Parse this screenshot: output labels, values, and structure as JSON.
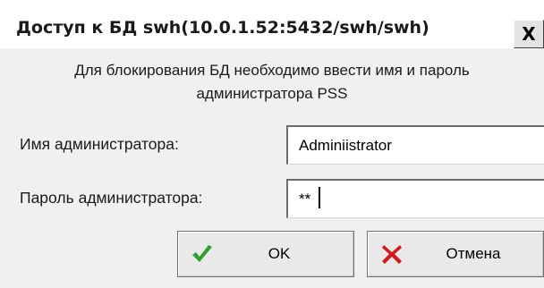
{
  "window": {
    "title": "Доступ к БД swh(10.0.1.52:5432/swh/swh)",
    "close_label": "X"
  },
  "message": {
    "line1": "Для блокирования БД необходимо ввести имя и пароль",
    "line2": "администратора PSS"
  },
  "form": {
    "username": {
      "label": "Имя администратора:",
      "value": "Adminiistrator"
    },
    "password": {
      "label": "Пароль администратора:",
      "value": "**"
    }
  },
  "buttons": {
    "ok": {
      "label": "OK",
      "icon": "check-icon",
      "color": "#2e9e2e"
    },
    "cancel": {
      "label": "Отмена",
      "icon": "cross-icon",
      "color": "#d21a1a"
    }
  }
}
